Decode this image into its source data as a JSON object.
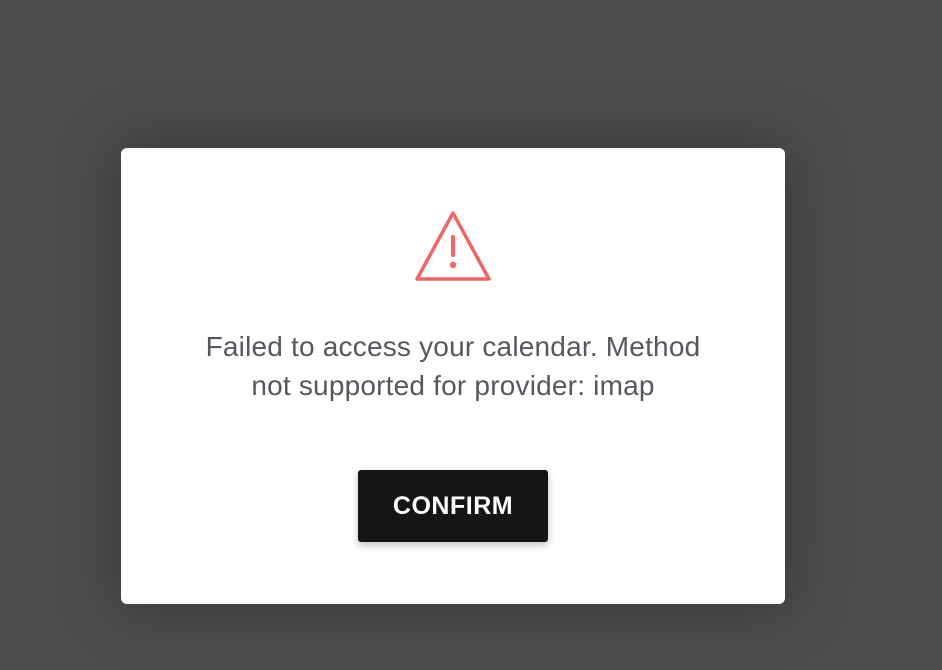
{
  "modal": {
    "icon": "warning-triangle-icon",
    "icon_color": "#f06565",
    "message_line1": "Failed to access your calendar. Method",
    "message_line2": "not supported for provider: imap",
    "confirm_label": "CONFIRM"
  },
  "colors": {
    "backdrop": "#4d4d4d",
    "dialog_bg": "#ffffff",
    "text": "#55585e",
    "button_bg": "#141517",
    "button_text": "#ffffff"
  }
}
